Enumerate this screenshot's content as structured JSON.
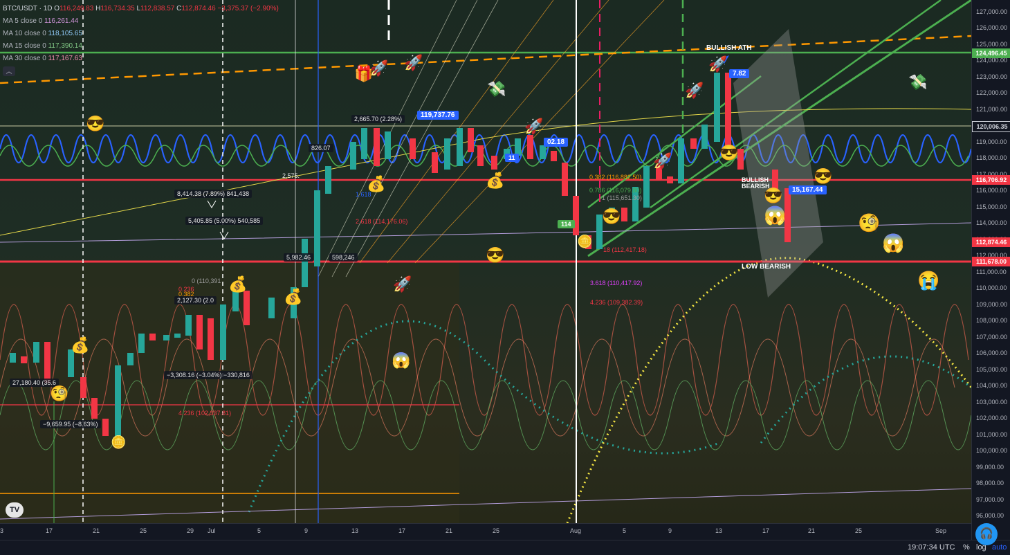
{
  "legend": {
    "symbol": "BTC/USDT · 1D",
    "ohlc": [
      {
        "key": "O",
        "value": "116,249.83"
      },
      {
        "key": "H",
        "value": "116,734.35"
      },
      {
        "key": "L",
        "value": "112,838.57"
      },
      {
        "key": "C",
        "value": "112,874.46"
      }
    ],
    "change": "−3,375.37 (−2.90%)",
    "moving_averages": [
      {
        "label": "MA 5 close 0",
        "value": "116,261.44",
        "color": "#ce93d8"
      },
      {
        "label": "MA 10 close 0",
        "value": "118,105.65",
        "color": "#90caf9"
      },
      {
        "label": "MA 15 close 0",
        "value": "117,390.14",
        "color": "#81c784"
      },
      {
        "label": "MA 30 close 0",
        "value": "117,167.63",
        "color": "#f48fb1"
      }
    ],
    "collapse_icon": "chevron-up-icon"
  },
  "price_axis": {
    "ticks": [
      "127,000.00",
      "126,000.00",
      "125,000.00",
      "124,000.00",
      "123,000.00",
      "122,000.00",
      "121,000.00",
      "120,000.00",
      "119,000.00",
      "118,000.00",
      "117,000.00",
      "116,000.00",
      "115,000.00",
      "114,000.00",
      "113,000.00",
      "112,000.00",
      "111,000.00",
      "110,000.00",
      "109,000.00",
      "108,000.00",
      "107,000.00",
      "106,000.00",
      "105,000.00",
      "104,000.00",
      "103,000.00",
      "102,000.00",
      "101,000.00",
      "100,000.00",
      "99,000.00",
      "98,000.00",
      "97,000.00",
      "96,000.00"
    ],
    "tags": [
      {
        "value": "124,496.45",
        "color": "#4caf50"
      },
      {
        "value": "120,006.35",
        "color": "#131722"
      },
      {
        "value": "116,706.92",
        "color": "#f23645"
      },
      {
        "value": "112,874.46",
        "color": "#f23645"
      },
      {
        "value": "111,678.00",
        "color": "#f23645"
      }
    ]
  },
  "time_axis": {
    "ticks": [
      "3",
      "17",
      "21",
      "25",
      "29",
      "Jul",
      "5",
      "9",
      "13",
      "17",
      "21",
      "25",
      "Aug",
      "5",
      "9",
      "13",
      "17",
      "21",
      "25",
      "Sep"
    ]
  },
  "annotations": {
    "bullish_ath": "BULLISH ATH",
    "bullish": "BULLISH",
    "bearish": "BEARISH",
    "low_bearish": "LOW BEARISH",
    "price_box_1": "119,737.76",
    "price_box_2": "15,167.44",
    "price_box_3": "02.18",
    "price_box_4": "7.82",
    "price_box_5": "11",
    "range_1": "8,414.38 (7.89%) 841,438",
    "range_2": "5,405.85 (5.00%) 540,585",
    "range_3": "−3,308.16 (−3.04%) −330,816",
    "range_4": "27,180.40 (35.6",
    "range_5": "−9,659.95 (−8.63%)",
    "range_6": "2,665.70 (2.28%)",
    "range_7": "5,982.46",
    "range_8": "598,246",
    "range_9": "2,127.30 (2.0",
    "range_10": "826.07",
    "fib_1": "1.618",
    "fib_2": "2.618 (114,176.06)",
    "fib_3": "3.618 (110,417.92)",
    "fib_4": "4.236 (109,382.39)",
    "fib_5": "18 (112,417.18)",
    "fib_6": "0.382 (116,882.50)",
    "fib_7": "0.786 (116,079.80)",
    "fib_8": "1 (115,651.30)",
    "fib_9": "4.236 (102,337.81)",
    "fib_10": "2,575.",
    "fib_11": "0 (110,391",
    "fib_12": "0.236",
    "fib_13": "0.382",
    "fib_14": "114"
  },
  "bottom_bar": {
    "time": "19:07:34 UTC",
    "percent": "%",
    "log": "log",
    "auto": "auto"
  },
  "logo": "TV",
  "support_icon": "headset-icon"
}
